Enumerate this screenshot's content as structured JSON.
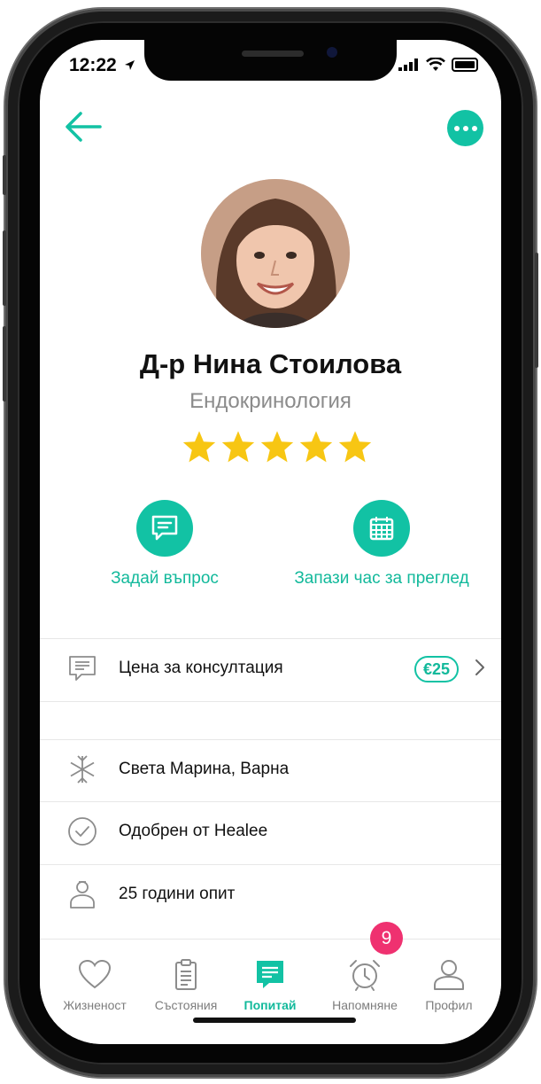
{
  "status_bar": {
    "time": "12:22"
  },
  "header": {
    "back_icon": "arrow-left-icon",
    "more_icon": "more-dots-icon"
  },
  "doctor": {
    "name": "Д-р Нина Стоилова",
    "specialty": "Ендокринология",
    "rating": 5,
    "rating_max": 5
  },
  "actions": [
    {
      "label": "Задай въпрос",
      "icon": "chat-icon"
    },
    {
      "label": "Запази час за преглед",
      "icon": "calendar-icon"
    }
  ],
  "details": {
    "consultation": {
      "label": "Цена за консултация",
      "price": "€25",
      "icon": "message-icon"
    },
    "location": {
      "label": "Света Марина, Варна",
      "icon": "asterisk-icon"
    },
    "approved": {
      "label": "Одобрен от Healee",
      "icon": "check-circle-icon"
    },
    "experience": {
      "label": "25 години опит",
      "icon": "person-icon"
    }
  },
  "tabs": [
    {
      "label": "Жизненост",
      "icon": "heart-icon",
      "active": false
    },
    {
      "label": "Състояния",
      "icon": "clipboard-icon",
      "active": false
    },
    {
      "label": "Попитай",
      "icon": "chat-icon",
      "active": true
    },
    {
      "label": "Напомняне",
      "icon": "alarm-icon",
      "active": false,
      "badge": "9"
    },
    {
      "label": "Профил",
      "icon": "profile-icon",
      "active": false
    }
  ],
  "colors": {
    "accent": "#12c2a4",
    "badge": "#ef3170",
    "star": "#f7c613"
  }
}
